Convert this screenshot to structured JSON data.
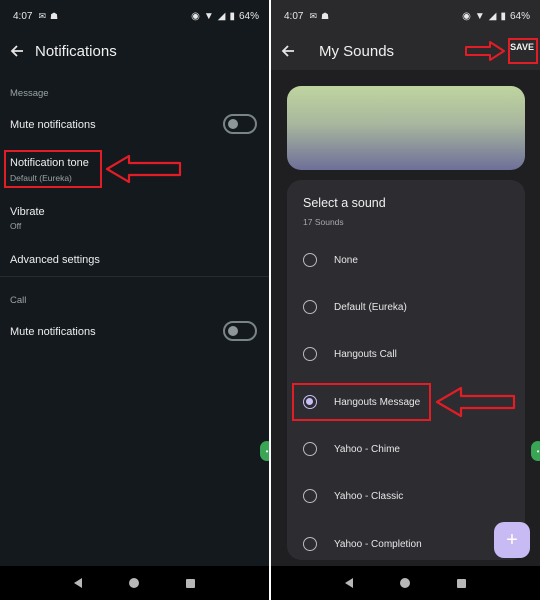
{
  "left": {
    "status": {
      "time": "4:07",
      "battery": "64%"
    },
    "title": "Notifications",
    "sections": {
      "message": "Message",
      "call": "Call"
    },
    "rows": {
      "mute_message": "Mute notifications",
      "notification_tone": "Notification tone",
      "notification_tone_value": "Default (Eureka)",
      "vibrate": "Vibrate",
      "vibrate_value": "Off",
      "advanced": "Advanced settings",
      "mute_call": "Mute notifications"
    }
  },
  "right": {
    "status": {
      "time": "4:07",
      "battery": "64%"
    },
    "title": "My Sounds",
    "save_label": "SAVE",
    "sheet_title": "Select a sound",
    "sheet_count": "17 Sounds",
    "sounds": [
      {
        "label": "None",
        "selected": false
      },
      {
        "label": "Default (Eureka)",
        "selected": false
      },
      {
        "label": "Hangouts Call",
        "selected": false
      },
      {
        "label": "Hangouts Message",
        "selected": true
      },
      {
        "label": "Yahoo - Chime",
        "selected": false
      },
      {
        "label": "Yahoo - Classic",
        "selected": false
      },
      {
        "label": "Yahoo - Completion",
        "selected": false
      }
    ],
    "fab": "+"
  },
  "colors": {
    "highlight": "#e31d25",
    "accent": "#c9bff6"
  }
}
